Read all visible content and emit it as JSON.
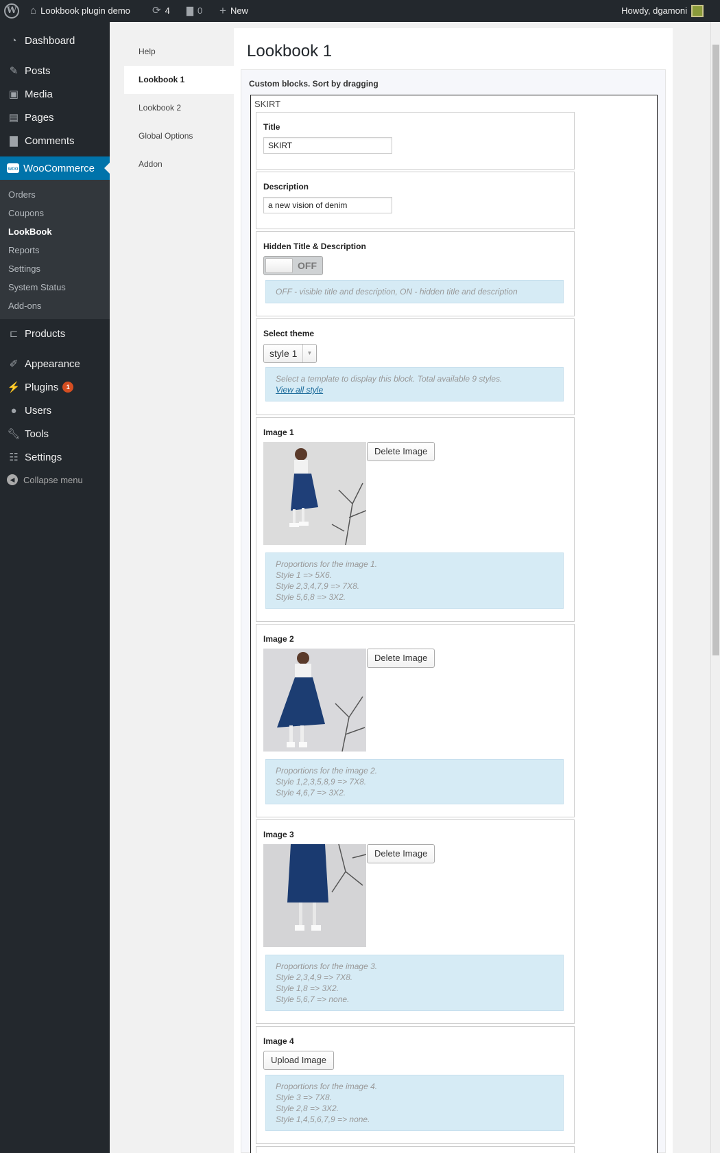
{
  "adminbar": {
    "site_name": "Lookbook plugin demo",
    "updates_count": "4",
    "comments_count": "0",
    "new_label": "New",
    "greeting": "Howdy, dgamoni"
  },
  "sidebar": {
    "dashboard": "Dashboard",
    "posts": "Posts",
    "media": "Media",
    "pages": "Pages",
    "comments": "Comments",
    "woocommerce": "WooCommerce",
    "woo_sub": [
      "Orders",
      "Coupons",
      "LookBook",
      "Reports",
      "Settings",
      "System Status",
      "Add-ons"
    ],
    "products": "Products",
    "appearance": "Appearance",
    "plugins": "Plugins",
    "plugins_badge": "1",
    "users": "Users",
    "tools": "Tools",
    "settings": "Settings",
    "collapse": "Collapse menu"
  },
  "tabs": [
    "Help",
    "Lookbook 1",
    "Lookbook 2",
    "Global Options",
    "Addon"
  ],
  "page": {
    "title": "Lookbook 1",
    "hint": "Custom blocks. Sort by dragging",
    "block_name": "SKIRT"
  },
  "fields": {
    "title_label": "Title",
    "title_value": "SKIRT",
    "desc_label": "Description",
    "desc_value": "a new vision of denim",
    "hidden_label": "Hidden Title & Description",
    "hidden_state": "OFF",
    "hidden_info": "OFF - visible title and description, ON - hidden title and description",
    "theme_label": "Select theme",
    "theme_value": "style 1",
    "theme_info": "Select a template to display this block. Total available 9 styles.",
    "theme_link": "View all style"
  },
  "images": [
    {
      "label": "Image 1",
      "button": "Delete Image",
      "info": [
        "Proportions for the image 1.",
        "Style 1 => 5X6.",
        "Style 2,3,4,7,9 => 7X8.",
        "Style 5,6,8 => 3X2."
      ]
    },
    {
      "label": "Image 2",
      "button": "Delete Image",
      "info": [
        "Proportions for the image 2.",
        "Style 1,2,3,5,8,9 => 7X8.",
        "Style 4,6,7 => 3X2."
      ]
    },
    {
      "label": "Image 3",
      "button": "Delete Image",
      "info": [
        "Proportions for the image 3.",
        "Style 2,3,4,9 => 7X8.",
        "Style 1,8 => 3X2.",
        "Style 5,6,7 => none."
      ]
    },
    {
      "label": "Image 4",
      "button": "Upload Image",
      "info": [
        "Proportions for the image 4.",
        "Style 3 => 7X8.",
        "Style 2,8 => 3X2.",
        "Style 1,4,5,6,7,9 => none."
      ]
    }
  ],
  "colors": {
    "admin_dark": "#23282d",
    "accent": "#0073aa",
    "info_bg": "#d6ebf5"
  }
}
